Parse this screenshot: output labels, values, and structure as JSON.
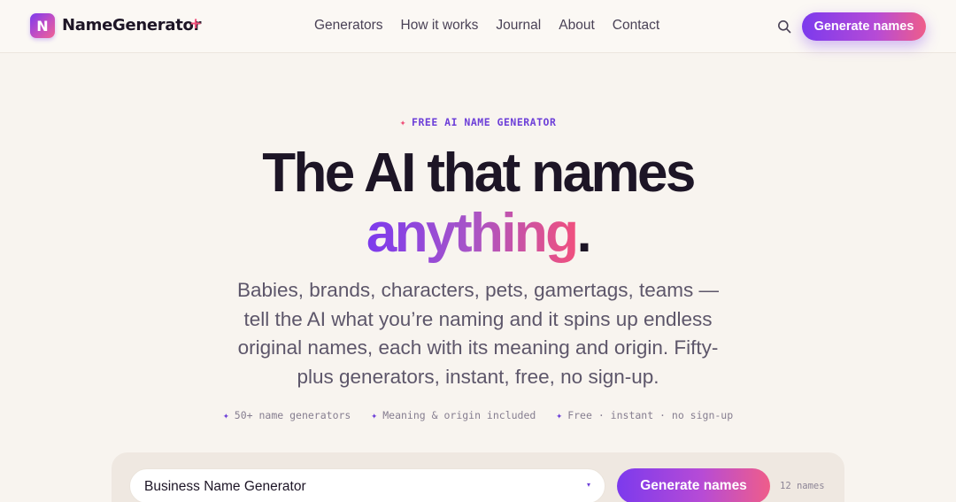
{
  "brand": {
    "logo_letter": "N",
    "name": "NameGenerator",
    "plus": "+"
  },
  "nav": {
    "items": [
      {
        "label": "Generators"
      },
      {
        "label": "How it works"
      },
      {
        "label": "Journal"
      },
      {
        "label": "About"
      },
      {
        "label": "Contact"
      }
    ],
    "search_icon": "search-icon",
    "cta_label": "Generate names"
  },
  "hero": {
    "eyebrow_spark": "✦",
    "eyebrow": "FREE AI NAME GENERATOR",
    "headline_line1": "The AI that names",
    "headline_highlight": "anything",
    "headline_dot": ".",
    "subtitle": "Babies, brands, characters, pets, gamertags, teams — tell the AI what you’re naming and it spins up endless original names, each with its meaning and origin. Fifty-plus generators, instant, free, no sign-up.",
    "features": [
      {
        "spark": "✦",
        "label": "50+ name generators"
      },
      {
        "spark": "✦",
        "label": "Meaning & origin included"
      },
      {
        "spark": "✦",
        "label": "Free · instant · no sign-up"
      }
    ]
  },
  "generator": {
    "selected_generator": "Business Name Generator",
    "caret": "▾",
    "button_label": "Generate names",
    "count_label": "12 names"
  },
  "colors": {
    "accent_purple": "#7c3aed",
    "accent_pink": "#ef5d8a",
    "background": "#f8f4ef",
    "text_dark": "#1d1526"
  }
}
